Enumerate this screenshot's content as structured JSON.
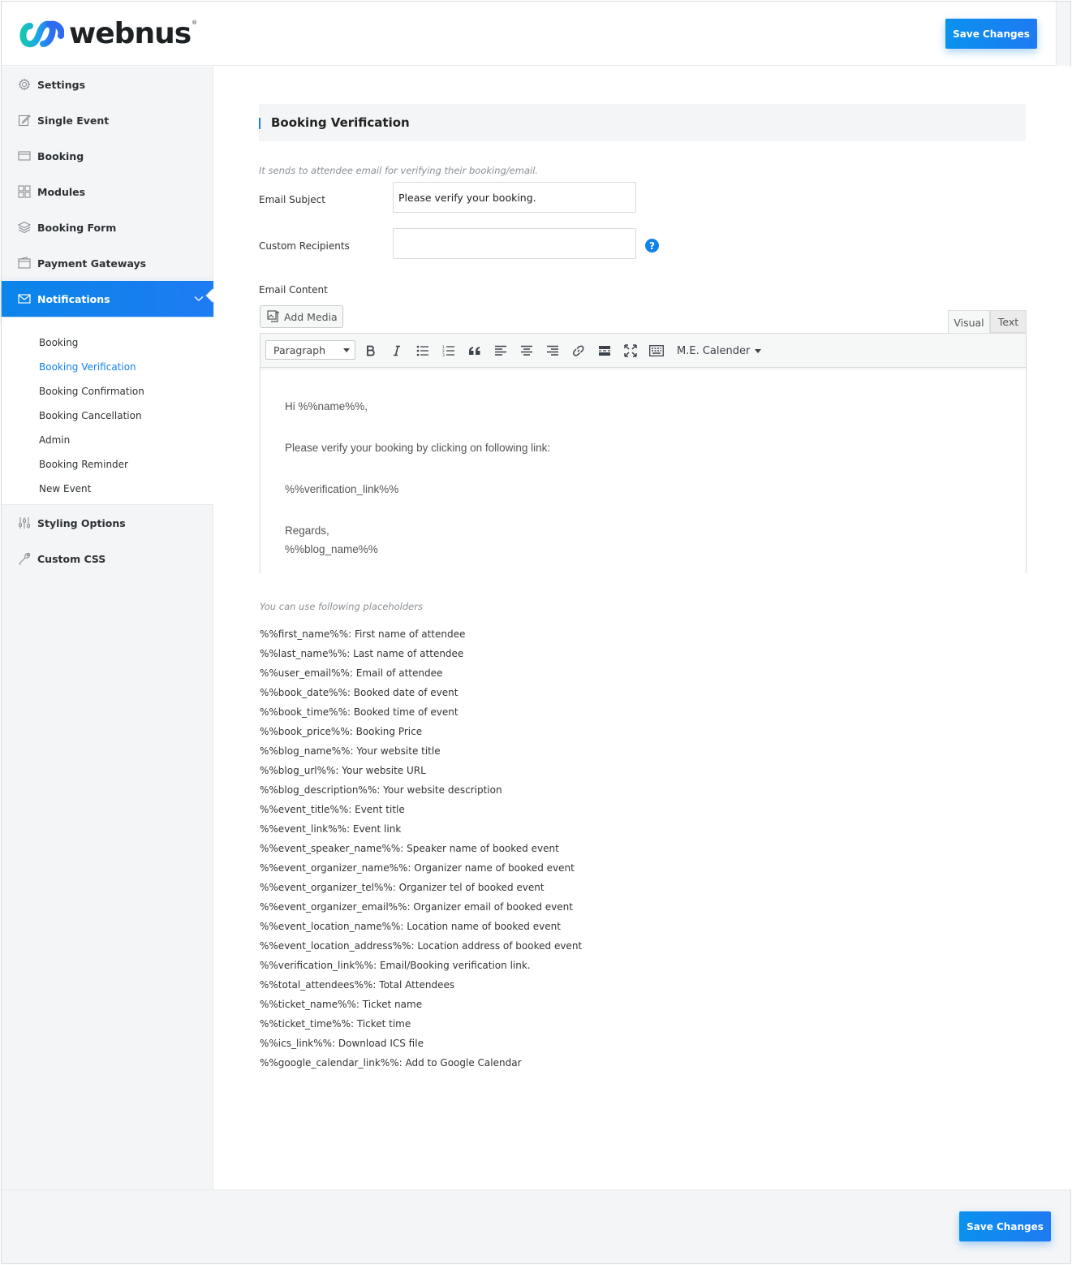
{
  "header": {
    "logo_text": "webnus",
    "logo_reg": "®",
    "save_label": "Save Changes"
  },
  "sidebar": {
    "items": [
      {
        "label": "Settings",
        "icon": "gear-icon"
      },
      {
        "label": "Single Event",
        "icon": "edit-icon"
      },
      {
        "label": "Booking",
        "icon": "card-icon"
      },
      {
        "label": "Modules",
        "icon": "grid-icon"
      },
      {
        "label": "Booking Form",
        "icon": "layers-icon"
      },
      {
        "label": "Payment Gateways",
        "icon": "wallet-icon"
      },
      {
        "label": "Notifications",
        "icon": "envelope-icon",
        "active": true
      },
      {
        "label": "Styling Options",
        "icon": "sliders-icon"
      },
      {
        "label": "Custom CSS",
        "icon": "wrench-icon"
      }
    ],
    "sub_items": [
      {
        "label": "Booking"
      },
      {
        "label": "Booking Verification",
        "active": true
      },
      {
        "label": "Booking Confirmation"
      },
      {
        "label": "Booking Cancellation"
      },
      {
        "label": "Admin"
      },
      {
        "label": "Booking Reminder"
      },
      {
        "label": "New Event"
      }
    ]
  },
  "main": {
    "section_title": "Booking Verification",
    "description": "It sends to attendee email for verifying their booking/email.",
    "email_subject_label": "Email Subject",
    "email_subject_value": "Please verify your booking.",
    "custom_recipients_label": "Custom Recipients",
    "custom_recipients_value": "",
    "help_glyph": "?",
    "email_content_label": "Email Content",
    "add_media_label": "Add Media",
    "tabs": {
      "visual": "Visual",
      "text": "Text"
    },
    "toolbar": {
      "format_value": "Paragraph",
      "calendar_label": "M.E. Calender"
    },
    "editor_lines": [
      "Hi %%name%%,",
      "Please verify your booking by clicking on following link:",
      "%%verification_link%%",
      "Regards,",
      "%%blog_name%%"
    ],
    "placeholders_note": "You can use following placeholders",
    "placeholders": [
      "%%first_name%%: First name of attendee",
      "%%last_name%%: Last name of attendee",
      "%%user_email%%: Email of attendee",
      "%%book_date%%: Booked date of event",
      "%%book_time%%: Booked time of event",
      "%%book_price%%: Booking Price",
      "%%blog_name%%: Your website title",
      "%%blog_url%%: Your website URL",
      "%%blog_description%%: Your website description",
      "%%event_title%%: Event title",
      "%%event_link%%: Event link",
      "%%event_speaker_name%%: Speaker name of booked event",
      "%%event_organizer_name%%: Organizer name of booked event",
      "%%event_organizer_tel%%: Organizer tel of booked event",
      "%%event_organizer_email%%: Organizer email of booked event",
      "%%event_location_name%%: Location name of booked event",
      "%%event_location_address%%: Location address of booked event",
      "%%verification_link%%: Email/Booking verification link.",
      "%%total_attendees%%: Total Attendees",
      "%%ticket_name%%: Ticket name",
      "%%ticket_time%%: Ticket time",
      "%%ics_link%%: Download ICS file",
      "%%google_calendar_link%%: Add to Google Calendar"
    ]
  },
  "footer": {
    "save_label": "Save Changes"
  },
  "colors": {
    "accent": "#1182ea",
    "sidebar_bg": "#f4f5f6"
  }
}
